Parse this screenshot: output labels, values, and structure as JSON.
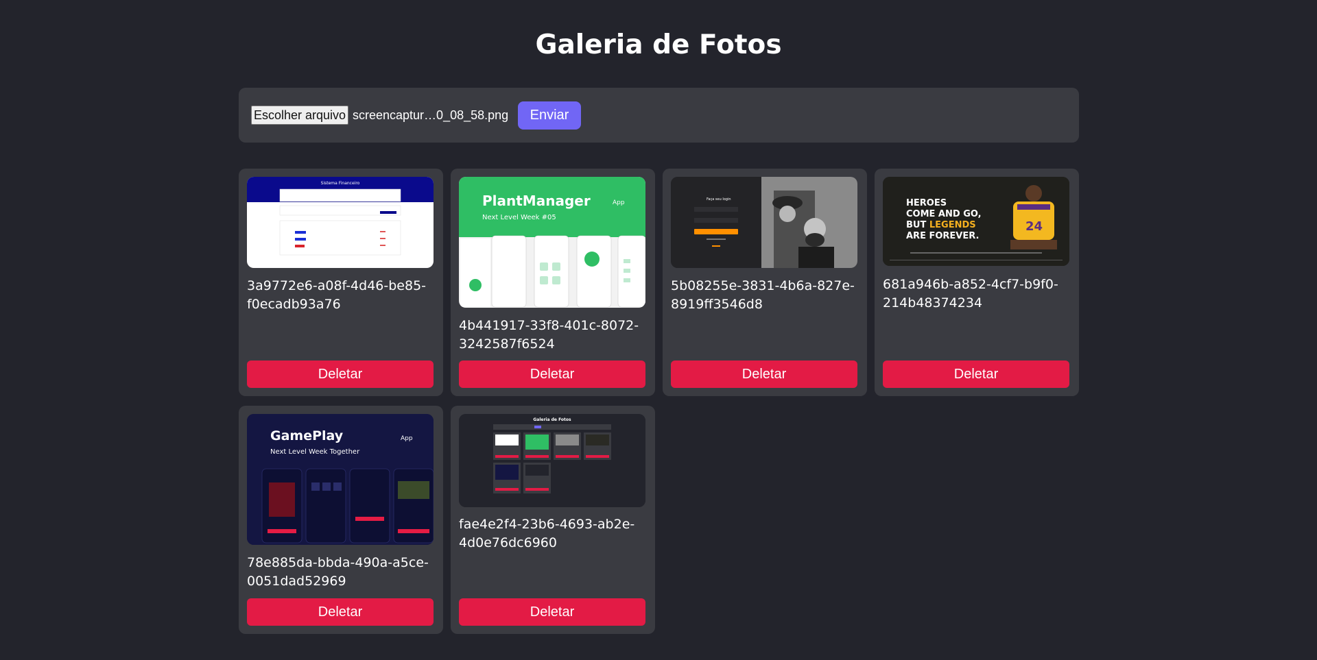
{
  "page": {
    "title": "Galeria de Fotos"
  },
  "upload": {
    "choose_file_label": "Escolher arquivo",
    "file_name": "screencaptur…0_08_58.png",
    "submit_label": "Enviar"
  },
  "photos": [
    {
      "id_line1": "3a9772e6-a08f-4d46-be85-",
      "id_line2": "f0ecadb93a76",
      "thumb_text": "Sistema Financeiro",
      "delete_label": "Deletar"
    },
    {
      "id_line1": "4b441917-33f8-401c-8072-",
      "id_line2": "3242587f6524",
      "thumb_text": "PlantManager",
      "thumb_subtext": "Next Level Week #05",
      "thumb_badge": "App",
      "delete_label": "Deletar"
    },
    {
      "id_line1": "5b08255e-3831-4b6a-827e-",
      "id_line2": "8919ff3546d8",
      "thumb_text": "Faça seu login",
      "delete_label": "Deletar"
    },
    {
      "id_line1": "681a946b-a852-4cf7-b9f0-",
      "id_line2": "214b48374234",
      "thumb_text": "HEROES COME AND GO, BUT LEGENDS ARE FOREVER.",
      "delete_label": "Deletar"
    },
    {
      "id_line1": "78e885da-bbda-490a-a5ce-",
      "id_line2": "0051dad52969",
      "thumb_text": "GamePlay",
      "thumb_subtext": "Next Level Week Together",
      "thumb_badge": "App",
      "delete_label": "Deletar"
    },
    {
      "id_line1": "fae4e2f4-23b6-4693-ab2e-",
      "id_line2": "4d0e76dc6960",
      "thumb_text": "Galeria de Fotos",
      "delete_label": "Deletar"
    }
  ],
  "colors": {
    "background": "#23242c",
    "panel": "#3a3b41",
    "submit": "#7166f5",
    "delete": "#e31b45"
  }
}
